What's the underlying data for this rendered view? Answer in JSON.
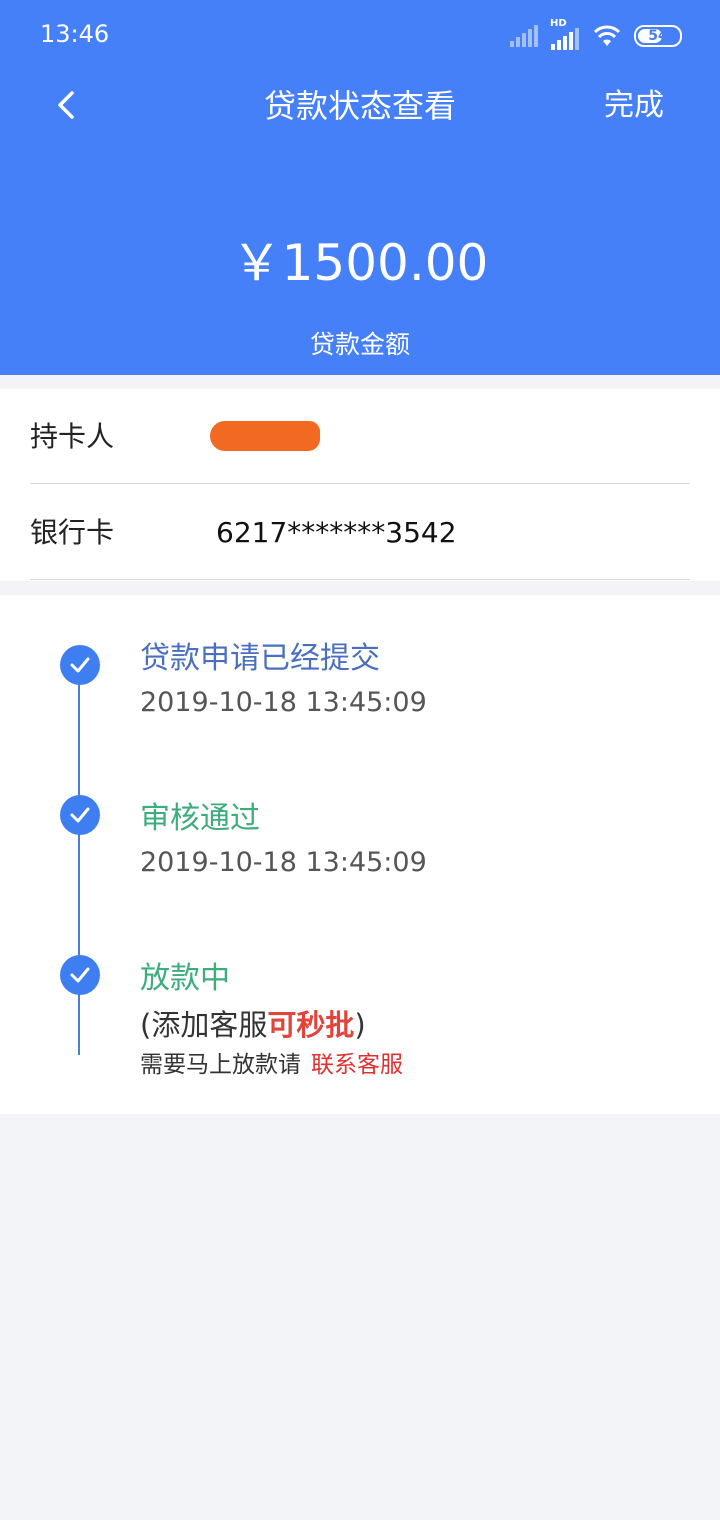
{
  "status_bar": {
    "time": "13:46",
    "network_badge": "HD",
    "battery": "54",
    "icons": [
      "signal-icon",
      "signal-hd-icon",
      "wifi-icon",
      "battery-icon"
    ]
  },
  "nav": {
    "back_icon": "chevron-left-icon",
    "title": "贷款状态查看",
    "done_label": "完成"
  },
  "loan": {
    "amount": "￥1500.00",
    "amount_label": "贷款金额"
  },
  "info": {
    "cardholder_label": "持卡人",
    "bank_card_label": "银行卡",
    "bank_card_value": "6217*******3542"
  },
  "timeline": [
    {
      "title": "贷款申请已经提交",
      "time": "2019-10-18 13:45:09"
    },
    {
      "title": "审核通过",
      "time": "2019-10-18 13:45:09"
    },
    {
      "title": "放款中",
      "note_prefix": "(添加客服",
      "note_highlight": "可秒批",
      "note_suffix": ")",
      "sub_text": "需要马上放款请",
      "contact_link": "联系客服"
    }
  ],
  "colors": {
    "header_blue": "#4580f8",
    "step1_title": "#4a6fbf",
    "step_green": "#3dad7c",
    "highlight_red": "#e0443a",
    "link_red": "#e03030",
    "dot_blue": "#3f7ef0"
  }
}
